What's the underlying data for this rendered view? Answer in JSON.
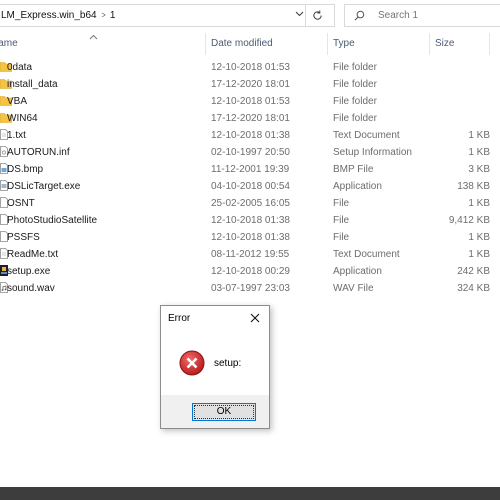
{
  "address_bar": {
    "breadcrumb": [
      "LM_Express.win_b64",
      "1"
    ],
    "chevron_icon": "chevron-down-icon",
    "refresh_icon": "refresh-icon"
  },
  "search": {
    "placeholder": "Search 1",
    "icon": "search-icon"
  },
  "columns": {
    "name": "Name",
    "date": "Date modified",
    "type": "Type",
    "size": "Size"
  },
  "files": [
    {
      "name": "0data",
      "date": "12-10-2018 01:53",
      "type": "File folder",
      "size": "",
      "icon": "folder-icon"
    },
    {
      "name": "install_data",
      "date": "17-12-2020 18:01",
      "type": "File folder",
      "size": "",
      "icon": "folder-icon"
    },
    {
      "name": "VBA",
      "date": "12-10-2018 01:53",
      "type": "File folder",
      "size": "",
      "icon": "folder-icon"
    },
    {
      "name": "WIN64",
      "date": "17-12-2020 18:01",
      "type": "File folder",
      "size": "",
      "icon": "folder-icon"
    },
    {
      "name": "1.txt",
      "date": "12-10-2018 01:38",
      "type": "Text Document",
      "size": "1 KB",
      "icon": "document-icon"
    },
    {
      "name": "AUTORUN.inf",
      "date": "02-10-1997 20:50",
      "type": "Setup Information",
      "size": "1 KB",
      "icon": "settings-file-icon"
    },
    {
      "name": "DS.bmp",
      "date": "11-12-2001 19:39",
      "type": "BMP File",
      "size": "3 KB",
      "icon": "image-file-icon"
    },
    {
      "name": "DSLicTarget.exe",
      "date": "04-10-2018 00:54",
      "type": "Application",
      "size": "138 KB",
      "icon": "application-icon"
    },
    {
      "name": "OSNT",
      "date": "25-02-2005 16:05",
      "type": "File",
      "size": "1 KB",
      "icon": "file-icon"
    },
    {
      "name": "PhotoStudioSatellite",
      "date": "12-10-2018 01:38",
      "type": "File",
      "size": "9,412 KB",
      "icon": "file-icon"
    },
    {
      "name": "PSSFS",
      "date": "12-10-2018 01:38",
      "type": "File",
      "size": "1 KB",
      "icon": "file-icon"
    },
    {
      "name": "ReadMe.txt",
      "date": "08-11-2012 19:55",
      "type": "Text Document",
      "size": "1 KB",
      "icon": "document-icon"
    },
    {
      "name": "setup.exe",
      "date": "12-10-2018 00:29",
      "type": "Application",
      "size": "242 KB",
      "icon": "setup-app-icon"
    },
    {
      "name": "sound.wav",
      "date": "03-07-1997 23:03",
      "type": "WAV File",
      "size": "324 KB",
      "icon": "audio-file-icon"
    }
  ],
  "dialog": {
    "title": "Error",
    "message": "setup:",
    "ok_label": "OK",
    "icon": "error-icon",
    "close_icon": "close-icon"
  },
  "colors": {
    "folder": "#f5c342",
    "error": "#d22d2d",
    "accent": "#0078d7",
    "header_text": "#4a5b73"
  }
}
